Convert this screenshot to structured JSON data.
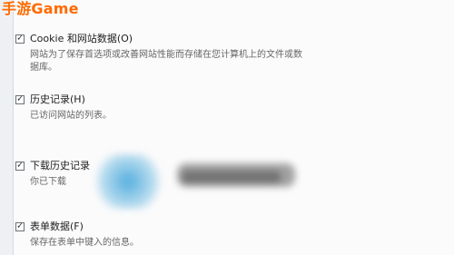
{
  "watermark": {
    "text": "手游Game",
    "color": "#ff6a00"
  },
  "options": [
    {
      "label": "Cookie 和网站数据(O)",
      "checked": true,
      "description": "网站为了保存首选项或改善网站性能而存储在您计算机上的文件或数\n据库。"
    },
    {
      "label": "历史记录(H)",
      "checked": true,
      "description": "已访问网站的列表。"
    },
    {
      "label": "下载历史记录",
      "checked": true,
      "description": "你已下载"
    },
    {
      "label": "表单数据(F)",
      "checked": true,
      "description": "保存在表单中键入的信息。"
    }
  ],
  "checkmark": "✓"
}
